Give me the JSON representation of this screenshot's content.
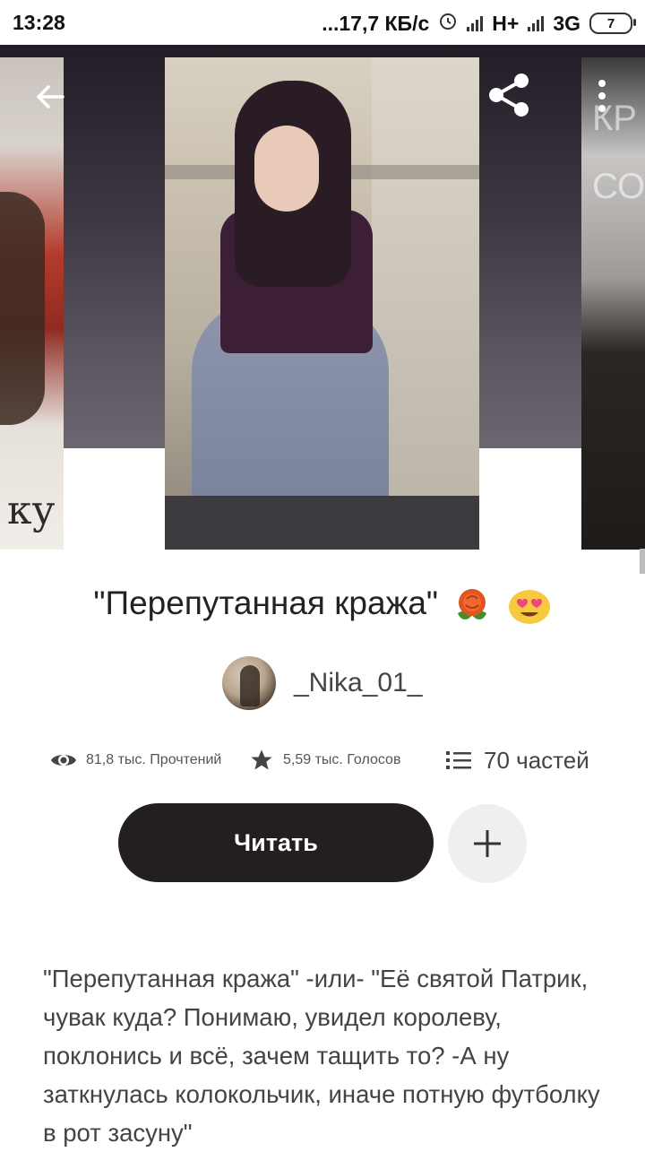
{
  "status_bar": {
    "time": "13:28",
    "network_speed": "...17,7 КБ/с",
    "net1": "H+",
    "net2": "3G",
    "battery": "7"
  },
  "hero": {
    "left_cover_text": "ку",
    "right_cover_text": "КР СО",
    "icons": {
      "back": "back-arrow-icon",
      "share": "share-icon",
      "more": "more-vert-icon"
    }
  },
  "story": {
    "title": "\"Перепутанная кража\"",
    "title_emojis": [
      "rose-emoji",
      "heart-eyes-emoji"
    ],
    "author": "_Nika_01_",
    "reads": "81,8 тыс. Прочтений",
    "votes": "5,59 тыс. Голосов",
    "parts": "70 частей",
    "read_button": "Читать",
    "add_icon": "plus-icon",
    "description": "\"Перепутанная кража\" -или- \"Её святой Патрик, чувак куда? Понимаю, увидел королеву, поклонись и всё, зачем тащить то? -А ну заткнулась колокольчик, иначе потную футболку в рот засуну\""
  },
  "colors": {
    "primary_button": "#231f21",
    "text": "#222222",
    "muted": "#555555"
  }
}
